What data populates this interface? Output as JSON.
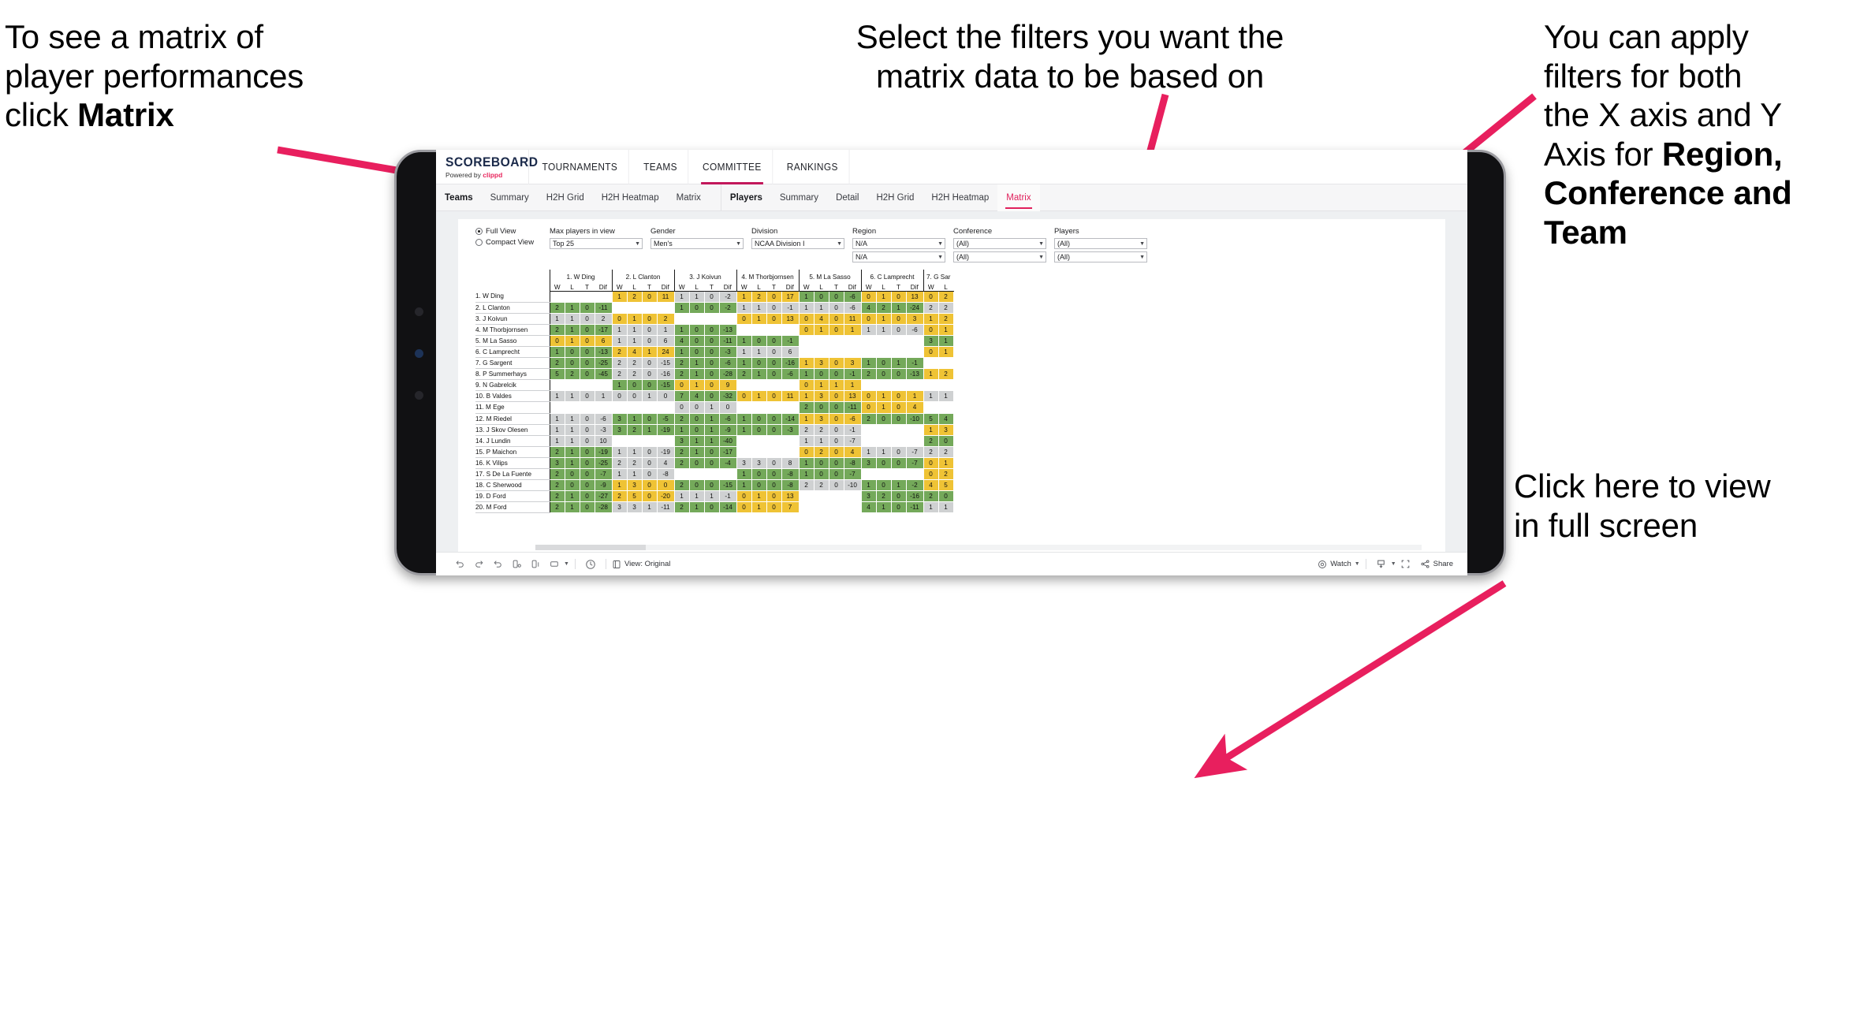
{
  "annotations": {
    "left": {
      "line1": "To see a matrix of",
      "line2": "player performances",
      "line3_pre": "click ",
      "line3_bold": "Matrix"
    },
    "mid": {
      "line1": "Select the filters you want the",
      "line2": "matrix data to be based on"
    },
    "right": {
      "line1": "You  can apply",
      "line2": "filters for both",
      "line3": "the X axis and Y",
      "line4_pre": "Axis for ",
      "line4_bold": "Region,",
      "line5_bold": "Conference and",
      "line6_bold": "Team"
    },
    "fullscreen": {
      "line1": "Click here to view",
      "line2": "in full screen"
    }
  },
  "app": {
    "brand": {
      "name": "SCOREBOARD",
      "powered_pre": "Powered by ",
      "powered_brand": "clippd"
    },
    "topnav": [
      {
        "label": "TOURNAMENTS",
        "active": false
      },
      {
        "label": "TEAMS",
        "active": false
      },
      {
        "label": "COMMITTEE",
        "active": true
      },
      {
        "label": "RANKINGS",
        "active": false
      }
    ],
    "subtabs": {
      "teams_group": {
        "lead": "Teams",
        "items": [
          "Summary",
          "H2H Grid",
          "H2H Heatmap",
          "Matrix"
        ]
      },
      "players_group": {
        "lead": "Players",
        "items": [
          "Summary",
          "Detail",
          "H2H Grid",
          "H2H Heatmap",
          "Matrix"
        ],
        "active": "Matrix"
      }
    }
  },
  "filters": {
    "view_modes": [
      {
        "label": "Full View",
        "selected": true
      },
      {
        "label": "Compact View",
        "selected": false
      }
    ],
    "controls": [
      {
        "label": "Max players in view",
        "value": "Top 25",
        "second": null
      },
      {
        "label": "Gender",
        "value": "Men's",
        "second": null
      },
      {
        "label": "Division",
        "value": "NCAA Division I",
        "second": null
      },
      {
        "label": "Region",
        "value": "N/A",
        "second": "N/A"
      },
      {
        "label": "Conference",
        "value": "(All)",
        "second": "(All)"
      },
      {
        "label": "Players",
        "value": "(All)",
        "second": "(All)"
      }
    ]
  },
  "matrix": {
    "stat_headers": [
      "W",
      "L",
      "T",
      "Dif"
    ],
    "columns": [
      "1. W Ding",
      "2. L Clanton",
      "3. J Koivun",
      "4. M Thorbjornsen",
      "5. M La Sasso",
      "6. C Lamprecht",
      "7. G Sar"
    ],
    "rows": [
      "1. W Ding",
      "2. L Clanton",
      "3. J Koivun",
      "4. M Thorbjornsen",
      "5. M La Sasso",
      "6. C Lamprecht",
      "7. G Sargent",
      "8. P Summerhays",
      "9. N Gabrelcik",
      "10. B Valdes",
      "11. M Ege",
      "12. M Riedel",
      "13. J Skov Olesen",
      "14. J Lundin",
      "15. P Maichon",
      "16. K Vilips",
      "17. S De La Fuente",
      "18. C Sherwood",
      "19. D Ford",
      "20. M Ford"
    ],
    "cells": [
      [
        null,
        [
          "y",
          1,
          2,
          0,
          "11"
        ],
        [
          "n",
          1,
          1,
          0,
          "-2"
        ],
        [
          "y",
          1,
          2,
          0,
          "17"
        ],
        [
          "g",
          1,
          0,
          0,
          "-6"
        ],
        [
          "y",
          0,
          1,
          0,
          "13"
        ],
        [
          "y",
          0,
          2
        ]
      ],
      [
        [
          "g",
          2,
          1,
          0,
          "-11"
        ],
        null,
        [
          "g",
          1,
          0,
          0,
          "-2"
        ],
        [
          "n",
          1,
          1,
          0,
          "-1"
        ],
        [
          "n",
          1,
          1,
          0,
          "-6"
        ],
        [
          "g",
          4,
          2,
          1,
          "-24"
        ],
        [
          "n",
          2,
          2
        ]
      ],
      [
        [
          "n",
          1,
          1,
          0,
          "2"
        ],
        [
          "y",
          0,
          1,
          0,
          "2"
        ],
        null,
        [
          "y",
          0,
          1,
          0,
          "13"
        ],
        [
          "y",
          0,
          4,
          0,
          "11"
        ],
        [
          "y",
          0,
          1,
          0,
          "3"
        ],
        [
          "y",
          1,
          2
        ]
      ],
      [
        [
          "g",
          2,
          1,
          0,
          "-17"
        ],
        [
          "n",
          1,
          1,
          0,
          "1"
        ],
        [
          "g",
          1,
          0,
          0,
          "-13"
        ],
        null,
        [
          "y",
          0,
          1,
          0,
          "1"
        ],
        [
          "n",
          1,
          1,
          0,
          "-6"
        ],
        [
          "y",
          0,
          1
        ]
      ],
      [
        [
          "y",
          0,
          1,
          0,
          "6"
        ],
        [
          "n",
          1,
          1,
          0,
          "6"
        ],
        [
          "g",
          4,
          0,
          0,
          "-11"
        ],
        [
          "g",
          1,
          0,
          0,
          "-1"
        ],
        null,
        null,
        [
          "g",
          3,
          1
        ]
      ],
      [
        [
          "g",
          1,
          0,
          0,
          "-13"
        ],
        [
          "y",
          2,
          4,
          1,
          "24"
        ],
        [
          "g",
          1,
          0,
          0,
          "-3"
        ],
        [
          "n",
          1,
          1,
          0,
          "6"
        ],
        null,
        null,
        [
          "y",
          0,
          1
        ]
      ],
      [
        [
          "g",
          2,
          0,
          0,
          "-25"
        ],
        [
          "n",
          2,
          2,
          0,
          "-15"
        ],
        [
          "g",
          2,
          1,
          0,
          "-6"
        ],
        [
          "g",
          1,
          0,
          0,
          "-16"
        ],
        [
          "y",
          1,
          3,
          0,
          "3"
        ],
        [
          "g",
          1,
          0,
          1,
          "-1"
        ],
        null
      ],
      [
        [
          "g",
          5,
          2,
          0,
          "-45"
        ],
        [
          "n",
          2,
          2,
          0,
          "-16"
        ],
        [
          "g",
          2,
          1,
          0,
          "-28"
        ],
        [
          "g",
          2,
          1,
          0,
          "-6"
        ],
        [
          "g",
          1,
          0,
          0,
          "-1"
        ],
        [
          "g",
          2,
          0,
          0,
          "-13"
        ],
        [
          "y",
          1,
          2
        ]
      ],
      [
        null,
        [
          "g",
          1,
          0,
          0,
          "-15"
        ],
        [
          "y",
          0,
          1,
          0,
          "9"
        ],
        null,
        [
          "y",
          0,
          1,
          1,
          "1"
        ],
        null,
        null
      ],
      [
        [
          "n",
          1,
          1,
          0,
          "1"
        ],
        [
          "n",
          0,
          0,
          1,
          "0"
        ],
        [
          "g",
          7,
          4,
          0,
          "-32"
        ],
        [
          "y",
          0,
          1,
          0,
          "11"
        ],
        [
          "y",
          1,
          3,
          0,
          "13"
        ],
        [
          "y",
          0,
          1,
          0,
          "1"
        ],
        [
          "n",
          1,
          1
        ]
      ],
      [
        null,
        null,
        [
          "n",
          0,
          0,
          1,
          "0"
        ],
        null,
        [
          "g",
          2,
          0,
          0,
          "-11"
        ],
        [
          "y",
          0,
          1,
          0,
          "4"
        ],
        null
      ],
      [
        [
          "n",
          1,
          1,
          0,
          "-6"
        ],
        [
          "g",
          3,
          1,
          0,
          "-5"
        ],
        [
          "g",
          2,
          0,
          1,
          "-6"
        ],
        [
          "g",
          1,
          0,
          0,
          "-14"
        ],
        [
          "y",
          1,
          3,
          0,
          "-6"
        ],
        [
          "g",
          2,
          0,
          0,
          "-10"
        ],
        [
          "g",
          5,
          4
        ]
      ],
      [
        [
          "n",
          1,
          1,
          0,
          "-3"
        ],
        [
          "g",
          3,
          2,
          1,
          "-19"
        ],
        [
          "g",
          1,
          0,
          1,
          "-9"
        ],
        [
          "g",
          1,
          0,
          0,
          "-3"
        ],
        [
          "n",
          2,
          2,
          0,
          "-1"
        ],
        null,
        [
          "y",
          1,
          3
        ]
      ],
      [
        [
          "n",
          1,
          1,
          0,
          "10"
        ],
        null,
        [
          "g",
          3,
          1,
          1,
          "-40"
        ],
        null,
        [
          "n",
          1,
          1,
          0,
          "-7"
        ],
        null,
        [
          "g",
          2,
          0
        ]
      ],
      [
        [
          "g",
          2,
          1,
          0,
          "-19"
        ],
        [
          "n",
          1,
          1,
          0,
          "-19"
        ],
        [
          "g",
          2,
          1,
          0,
          "-17"
        ],
        null,
        [
          "y",
          0,
          2,
          0,
          "4"
        ],
        [
          "n",
          1,
          1,
          0,
          "-7"
        ],
        [
          "n",
          2,
          2
        ]
      ],
      [
        [
          "g",
          3,
          1,
          0,
          "-25"
        ],
        [
          "n",
          2,
          2,
          0,
          "4"
        ],
        [
          "g",
          2,
          0,
          0,
          "-4"
        ],
        [
          "n",
          3,
          3,
          0,
          "8"
        ],
        [
          "g",
          1,
          0,
          0,
          "-8"
        ],
        [
          "g",
          3,
          0,
          0,
          "-7"
        ],
        [
          "y",
          0,
          1
        ]
      ],
      [
        [
          "g",
          2,
          0,
          0,
          "-7"
        ],
        [
          "n",
          1,
          1,
          0,
          "-8"
        ],
        null,
        [
          "g",
          1,
          0,
          0,
          "-8"
        ],
        [
          "g",
          1,
          0,
          0,
          "-7"
        ],
        null,
        [
          "y",
          0,
          2
        ]
      ],
      [
        [
          "g",
          2,
          0,
          0,
          "-9"
        ],
        [
          "y",
          1,
          3,
          0,
          "0"
        ],
        [
          "g",
          2,
          0,
          0,
          "-15"
        ],
        [
          "g",
          1,
          0,
          0,
          "-8"
        ],
        [
          "n",
          2,
          2,
          0,
          "-10"
        ],
        [
          "g",
          1,
          0,
          1,
          "-2"
        ],
        [
          "y",
          4,
          5
        ]
      ],
      [
        [
          "g",
          2,
          1,
          0,
          "-27"
        ],
        [
          "y",
          2,
          5,
          0,
          "-20"
        ],
        [
          "n",
          1,
          1,
          1,
          "-1"
        ],
        [
          "y",
          0,
          1,
          0,
          "13"
        ],
        null,
        [
          "g",
          3,
          2,
          0,
          "-16"
        ],
        [
          "g",
          2,
          0
        ]
      ],
      [
        [
          "g",
          2,
          1,
          0,
          "-28"
        ],
        [
          "n",
          3,
          3,
          1,
          "-11"
        ],
        [
          "g",
          2,
          1,
          0,
          "-14"
        ],
        [
          "y",
          0,
          1,
          0,
          "7"
        ],
        null,
        [
          "g",
          4,
          1,
          0,
          "-11"
        ],
        [
          "n",
          1,
          1
        ]
      ]
    ]
  },
  "toolbar": {
    "view_label": "View: Original",
    "watch_label": "Watch",
    "share_label": "Share"
  },
  "colors": {
    "accent_pink": "#e8275e",
    "arrow_pink": "#e81f5e",
    "nav_active": "#c2185b",
    "green": "#74a95a",
    "yellow": "#efc335",
    "grey": "#cfd1d2"
  }
}
